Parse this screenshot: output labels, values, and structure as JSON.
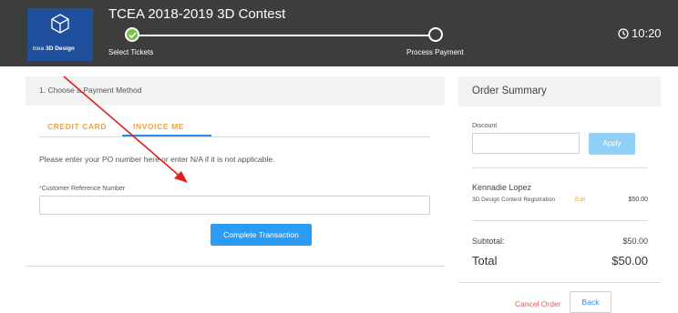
{
  "header": {
    "logo": {
      "brand_prefix": "tcea",
      "brand_name": "3D Design"
    },
    "title": "TCEA 2018-2019 3D Contest",
    "steps": [
      {
        "label": "Select Tickets",
        "status": "complete"
      },
      {
        "label": "Process Payment",
        "status": "current"
      }
    ],
    "timer": "10:20"
  },
  "payment": {
    "section_title": "1. Choose a Payment Method",
    "tabs": [
      {
        "label": "CREDIT CARD",
        "active": false
      },
      {
        "label": "INVOICE ME",
        "active": true
      }
    ],
    "instruction": "Please enter your PO number here or enter N/A if it is not applicable.",
    "field": {
      "required_marker": "*",
      "label": "Customer Reference Number",
      "value": "",
      "placeholder": ""
    },
    "complete_label": "Complete Transaction"
  },
  "summary": {
    "title": "Order Summary",
    "discount_label": "Discount",
    "discount_value": "",
    "apply_label": "Apply",
    "customer": "Kennadie Lopez",
    "item": {
      "name": "3D Design Contest Registration",
      "edit_label": "Edit",
      "price": "$50.00"
    },
    "subtotal_label": "Subtotal:",
    "subtotal_value": "$50.00",
    "total_label": "Total",
    "total_value": "$50.00",
    "cancel_label": "Cancel Order",
    "back_label": "Back"
  },
  "colors": {
    "header_bg": "#3d3d3d",
    "logo_bg": "#1f4f9c",
    "step_complete": "#7ac143",
    "accent_blue": "#2b9bf4",
    "tab_orange": "#f2a23a",
    "cancel_red": "#e35b5b",
    "annotation_arrow": "#e02020"
  },
  "icons": [
    "cube-icon",
    "check-icon",
    "clock-icon"
  ]
}
